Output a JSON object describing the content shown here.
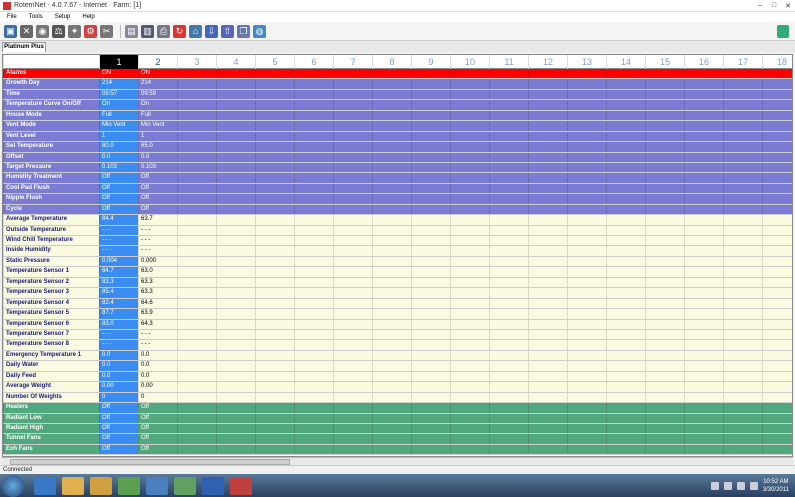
{
  "window": {
    "title": "RotemNet - 4.0.7.67 - Internet · Farm: [1]"
  },
  "menu": [
    "File",
    "Tools",
    "Setup",
    "Help"
  ],
  "tab": {
    "label": "Platinum Plus"
  },
  "columns": [
    "1",
    "2",
    "3",
    "4",
    "5",
    "6",
    "7",
    "8",
    "9",
    "10",
    "11",
    "12",
    "13",
    "14",
    "15",
    "16",
    "17",
    "18"
  ],
  "rows": [
    {
      "label": "Alarms",
      "style": "red",
      "v1": "ON",
      "v2": "ON"
    },
    {
      "label": "Growth Day",
      "style": "purple",
      "v1": "214",
      "v2": "214"
    },
    {
      "label": "Time",
      "style": "purple",
      "v1": "09:57",
      "v2": "09:59"
    },
    {
      "label": "Temperature Curve On/Off",
      "style": "purple",
      "v1": "On",
      "v2": "On"
    },
    {
      "label": "House Mode",
      "style": "purple",
      "v1": "Full",
      "v2": "Full"
    },
    {
      "label": "Vent Mode",
      "style": "purple",
      "v1": "Min Vent",
      "v2": "Min Vent"
    },
    {
      "label": "Vent Level",
      "style": "purple",
      "v1": "1",
      "v2": "1"
    },
    {
      "label": "Set Temperature",
      "style": "purple",
      "v1": "80.0",
      "v2": "65.0"
    },
    {
      "label": "Offset",
      "style": "purple",
      "v1": "0.0",
      "v2": "0.0"
    },
    {
      "label": "Target Pressure",
      "style": "purple",
      "v1": "0.103",
      "v2": "0.103"
    },
    {
      "label": "Humidity Treatment",
      "style": "purple",
      "v1": "Off",
      "v2": "Off"
    },
    {
      "label": "Cool Pad Flush",
      "style": "purple",
      "v1": "Off",
      "v2": "Off"
    },
    {
      "label": "Nipple Flush",
      "style": "purple",
      "v1": "Off",
      "v2": "Off"
    },
    {
      "label": "Cycle",
      "style": "purple",
      "v1": "Off",
      "v2": "Off"
    },
    {
      "label": "Average Temperature",
      "style": "cream",
      "v1": "84.4",
      "v2": "63.7"
    },
    {
      "label": "Outside Temperature",
      "style": "cream",
      "v1": "- - -",
      "v2": "- - -"
    },
    {
      "label": "Wind Chill Temperature",
      "style": "cream",
      "v1": "- - -",
      "v2": "- - -"
    },
    {
      "label": "Inside Humidity",
      "style": "cream",
      "v1": "- - -",
      "v2": "- - -"
    },
    {
      "label": "Static Pressure",
      "style": "cream",
      "v1": "0.004",
      "v2": "0.000"
    },
    {
      "label": "Temperature Sensor 1",
      "style": "cream",
      "v1": "84.7",
      "v2": "63.0"
    },
    {
      "label": "Temperature Sensor 2",
      "style": "cream",
      "v1": "83.3",
      "v2": "63.3"
    },
    {
      "label": "Temperature Sensor 3",
      "style": "cream",
      "v1": "85.4",
      "v2": "63.3"
    },
    {
      "label": "Temperature Sensor 4",
      "style": "cream",
      "v1": "82.4",
      "v2": "64.6"
    },
    {
      "label": "Temperature Sensor 5",
      "style": "cream",
      "v1": "87.7",
      "v2": "63.9"
    },
    {
      "label": "Temperature Sensor 6",
      "style": "cream",
      "v1": "83.0",
      "v2": "64.3"
    },
    {
      "label": "Temperature Sensor 7",
      "style": "cream",
      "v1": "- - -",
      "v2": "- - -"
    },
    {
      "label": "Temperature Sensor 8",
      "style": "cream",
      "v1": "- - -",
      "v2": "- - -"
    },
    {
      "label": "Emergency Temperature 1",
      "style": "cream",
      "v1": "0.0",
      "v2": "0.0"
    },
    {
      "label": "Daily Water",
      "style": "cream",
      "v1": "0.0",
      "v2": "0.0"
    },
    {
      "label": "Daily Feed",
      "style": "cream",
      "v1": "0.0",
      "v2": "0.0"
    },
    {
      "label": "Average Weight",
      "style": "cream",
      "v1": "0.00",
      "v2": "0.00"
    },
    {
      "label": "Number Of Weights",
      "style": "cream",
      "v1": "0",
      "v2": "0"
    },
    {
      "label": "Heaters",
      "style": "green",
      "v1": "Off",
      "v2": "Off"
    },
    {
      "label": "Radiant Low",
      "style": "green",
      "v1": "Off",
      "v2": "Off"
    },
    {
      "label": "Radiant High",
      "style": "green",
      "v1": "Off",
      "v2": "Off"
    },
    {
      "label": "Tunnel Fans",
      "style": "green",
      "v1": "Off",
      "v2": "Off"
    },
    {
      "label": "Exh Fans",
      "style": "green",
      "v1": "Off",
      "v2": "Off"
    }
  ],
  "status": {
    "text": "Connected"
  },
  "clock": {
    "time": "10:52 AM",
    "date": "3/30/2011"
  },
  "toolbar_icons": [
    "monitor-icon",
    "tools-icon",
    "tractor-icon",
    "balance-icon",
    "bird-icon",
    "gear-icon",
    "repair-icon",
    "document-icon",
    "chart-icon",
    "print-icon",
    "refresh-icon",
    "farm-icon",
    "import-icon",
    "export-icon",
    "copy-icon",
    "globe-icon"
  ]
}
